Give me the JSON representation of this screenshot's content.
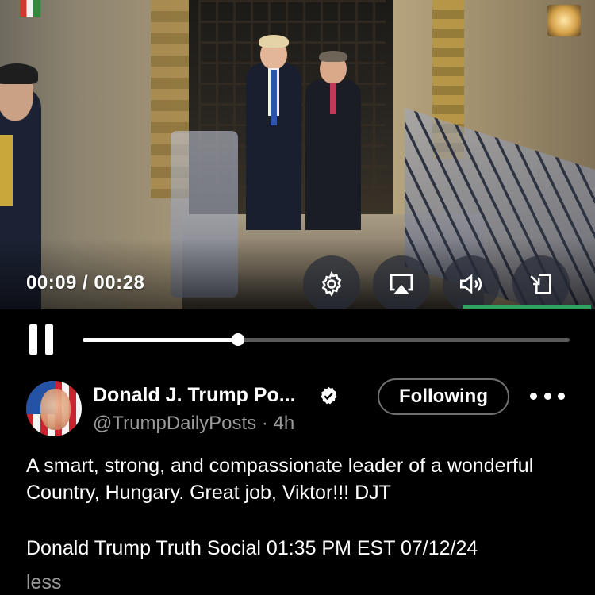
{
  "video": {
    "current_time": "00:09",
    "separator": " / ",
    "duration": "00:28",
    "progress_fraction": 0.32,
    "controls": [
      "settings-icon",
      "airplay-icon",
      "volume-icon",
      "popout-icon"
    ]
  },
  "post": {
    "author_name": "Donald J. Trump Po...",
    "handle": "@TrumpDailyPosts",
    "dot": " · ",
    "age": "4h",
    "follow_label": "Following",
    "text": "A smart, strong, and compassionate leader of a wonderful Country, Hungary. Great job, Viktor!!! DJT",
    "source": "Donald Trump Truth Social 01:35 PM EST 07/12/24",
    "less_label": "less"
  },
  "colors": {
    "background": "#000000",
    "secondary_text": "#9a9a9a",
    "accent_green": "#2ea25f"
  }
}
